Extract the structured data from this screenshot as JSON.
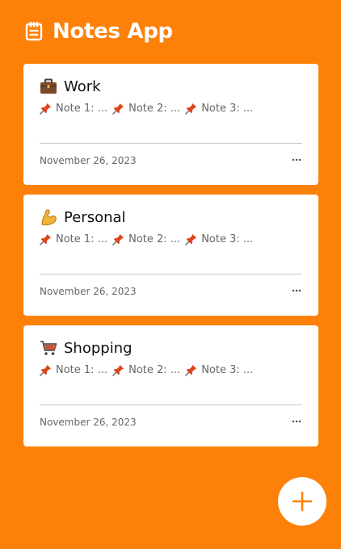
{
  "app": {
    "title": "Notes App",
    "icon": "notepad-icon"
  },
  "colors": {
    "background": "#fd8109",
    "card": "#ffffff",
    "accent": "#fd8109",
    "pin": "#e0421a"
  },
  "cards": [
    {
      "emoji": "💼",
      "emoji_name": "briefcase-icon",
      "title": "Work",
      "notes": [
        "Note 1: ...",
        "Note 2: ...",
        "Note 3: ..."
      ],
      "date": "November 26, 2023",
      "more_icon": "more-horizontal-icon"
    },
    {
      "emoji": "💪",
      "emoji_name": "flexed-biceps-icon",
      "title": "Personal",
      "notes": [
        "Note 1: ...",
        "Note 2: ...",
        "Note 3: ..."
      ],
      "date": "November 26, 2023",
      "more_icon": "more-horizontal-icon"
    },
    {
      "emoji": "🛒",
      "emoji_name": "shopping-cart-icon",
      "title": "Shopping",
      "notes": [
        "Note 1: ...",
        "Note 2: ...",
        "Note 3: ..."
      ],
      "date": "November 26, 2023",
      "more_icon": "more-horizontal-icon"
    }
  ],
  "fab": {
    "icon": "plus-icon"
  }
}
